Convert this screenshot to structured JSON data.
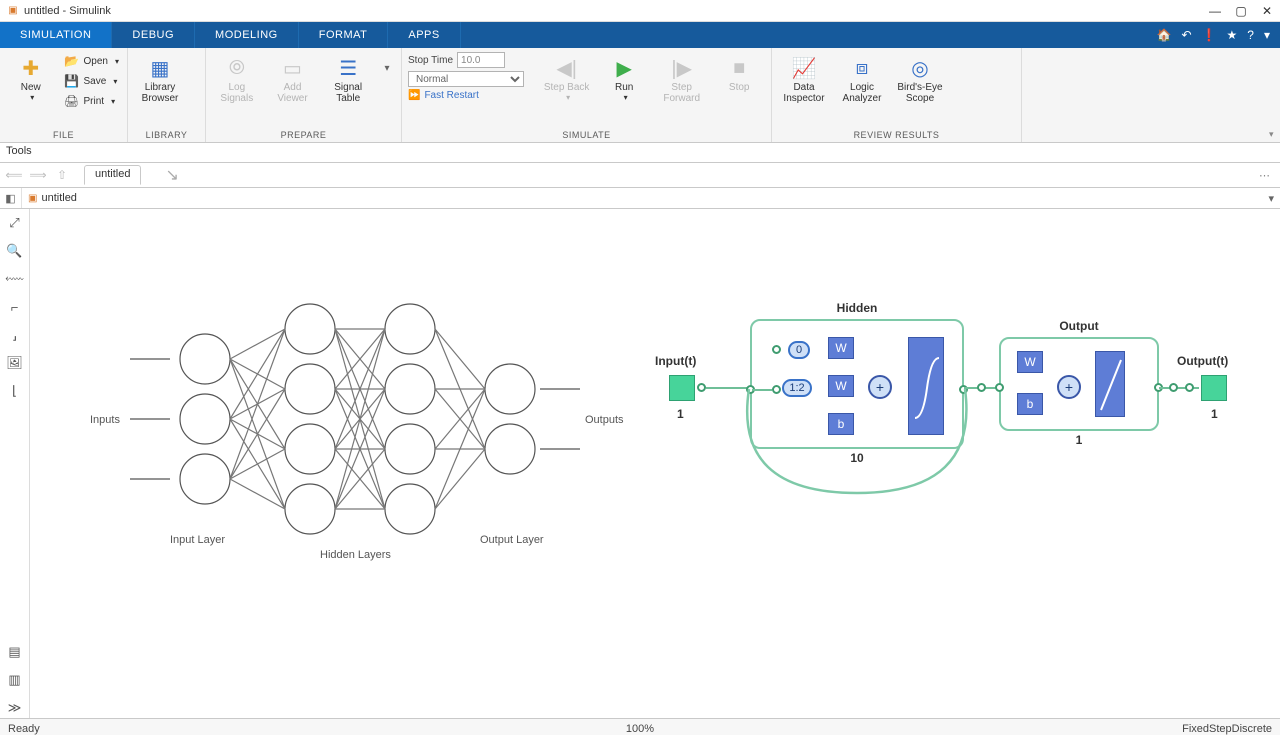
{
  "titlebar": {
    "title": "untitled - Simulink"
  },
  "ribbon_tabs": [
    "SIMULATION",
    "DEBUG",
    "MODELING",
    "FORMAT",
    "APPS"
  ],
  "ribbon": {
    "file": {
      "group": "FILE",
      "new": "New",
      "open": "Open",
      "save": "Save",
      "print": "Print"
    },
    "library": {
      "group": "LIBRARY",
      "browser": "Library Browser"
    },
    "prepare": {
      "group": "PREPARE",
      "log": "Log Signals",
      "add": "Add Viewer",
      "signal": "Signal Table"
    },
    "simulate": {
      "group": "SIMULATE",
      "stoptime_label": "Stop Time",
      "stoptime": "10.0",
      "mode": "Normal",
      "fastrestart": "Fast Restart",
      "stepback": "Step Back",
      "run": "Run",
      "stepfwd": "Step Forward",
      "stop": "Stop"
    },
    "review": {
      "group": "REVIEW RESULTS",
      "datainspector": "Data Inspector",
      "logic": "Logic Analyzer",
      "birdseye": "Bird's-Eye Scope"
    }
  },
  "toolsbar": "Tools",
  "nav": {
    "tab": "untitled",
    "path": "untitled"
  },
  "nn_labels": {
    "inputs": "Inputs",
    "input_layer": "Input Layer",
    "hidden_layers": "Hidden Layers",
    "output_layer": "Output Layer",
    "outputs": "Outputs"
  },
  "simnn": {
    "input_label": "Input(t)",
    "input_sz": "1",
    "hidden": {
      "title": "Hidden",
      "delay0": "0",
      "delay12": "1:2",
      "w": "W",
      "b": "b",
      "size": "10"
    },
    "output": {
      "title": "Output",
      "w": "W",
      "b": "b",
      "size": "1"
    },
    "out_label": "Output(t)",
    "out_sz": "1"
  },
  "status": {
    "left": "Ready",
    "center": "100%",
    "right": "FixedStepDiscrete"
  }
}
